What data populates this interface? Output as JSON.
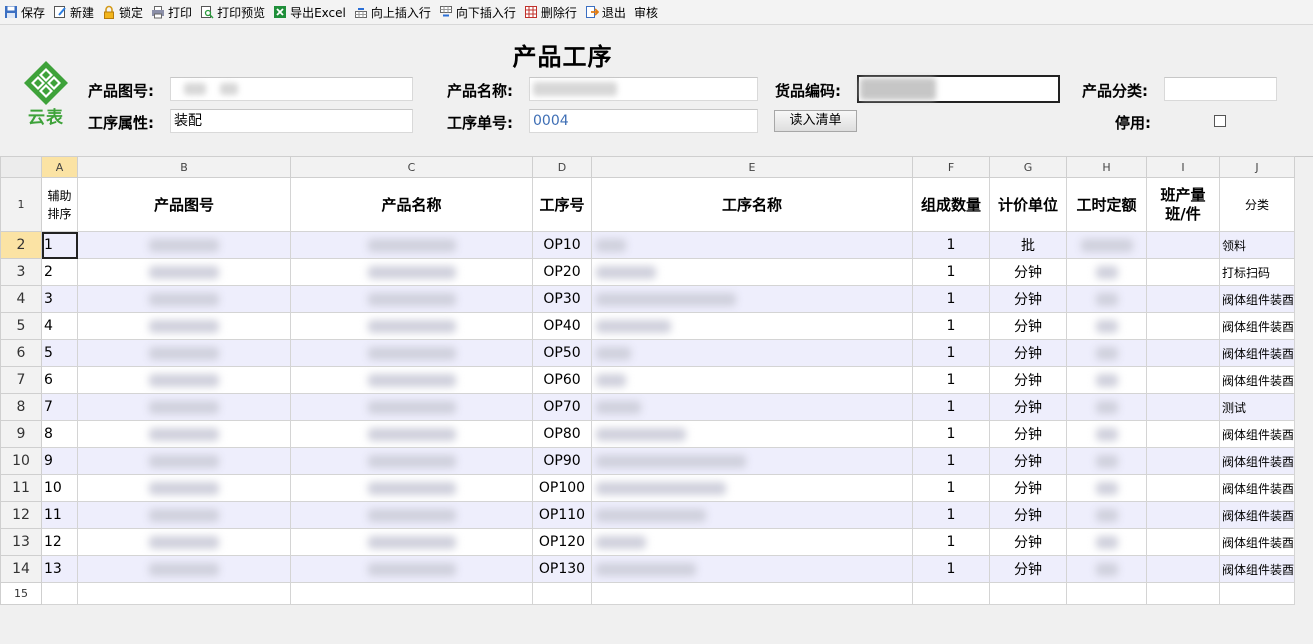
{
  "toolbar": {
    "save": "保存",
    "new": "新建",
    "lock": "锁定",
    "print": "打印",
    "print_preview": "打印预览",
    "export_excel": "导出Excel",
    "insert_above": "向上插入行",
    "insert_below": "向下插入行",
    "delete_row": "删除行",
    "exit": "退出",
    "audit": "审核"
  },
  "form": {
    "title": "产品工序",
    "logo_text": "云表",
    "product_drawing_label": "产品图号:",
    "product_name_label": "产品名称:",
    "goods_code_label": "货品编码:",
    "product_category_label": "产品分类:",
    "process_attr_label": "工序属性:",
    "process_attr_value": "装配",
    "process_no_label": "工序单号:",
    "process_no_value": "0004",
    "import_button": "读入清单",
    "disabled_label": "停用:"
  },
  "grid": {
    "col_letters": [
      "A",
      "B",
      "C",
      "D",
      "E",
      "F",
      "G",
      "H",
      "I",
      "J"
    ],
    "headers": [
      "辅助排序",
      "产品图号",
      "产品名称",
      "工序号",
      "工序名称",
      "组成数量",
      "计价单位",
      "工时定额",
      "班产量班/件",
      "分类"
    ],
    "header_a_lines": [
      "辅助",
      "排序"
    ],
    "header_i_lines": [
      "班产量",
      "班/件"
    ],
    "rows": [
      {
        "rn": "2",
        "seq": "1",
        "op": "OP10",
        "qty": "1",
        "unit": "批",
        "cat": "领料"
      },
      {
        "rn": "3",
        "seq": "2",
        "op": "OP20",
        "qty": "1",
        "unit": "分钟",
        "cat": "打标扫码"
      },
      {
        "rn": "4",
        "seq": "3",
        "op": "OP30",
        "qty": "1",
        "unit": "分钟",
        "cat": "阀体组件装酉"
      },
      {
        "rn": "5",
        "seq": "4",
        "op": "OP40",
        "qty": "1",
        "unit": "分钟",
        "cat": "阀体组件装酉"
      },
      {
        "rn": "6",
        "seq": "5",
        "op": "OP50",
        "qty": "1",
        "unit": "分钟",
        "cat": "阀体组件装酉"
      },
      {
        "rn": "7",
        "seq": "6",
        "op": "OP60",
        "qty": "1",
        "unit": "分钟",
        "cat": "阀体组件装酉"
      },
      {
        "rn": "8",
        "seq": "7",
        "op": "OP70",
        "qty": "1",
        "unit": "分钟",
        "cat": "测试"
      },
      {
        "rn": "9",
        "seq": "8",
        "op": "OP80",
        "qty": "1",
        "unit": "分钟",
        "cat": "阀体组件装酉"
      },
      {
        "rn": "10",
        "seq": "9",
        "op": "OP90",
        "qty": "1",
        "unit": "分钟",
        "cat": "阀体组件装酉"
      },
      {
        "rn": "11",
        "seq": "10",
        "op": "OP100",
        "qty": "1",
        "unit": "分钟",
        "cat": "阀体组件装酉"
      },
      {
        "rn": "12",
        "seq": "11",
        "op": "OP110",
        "qty": "1",
        "unit": "分钟",
        "cat": "阀体组件装酉"
      },
      {
        "rn": "13",
        "seq": "12",
        "op": "OP120",
        "qty": "1",
        "unit": "分钟",
        "cat": "阀体组件装酉"
      },
      {
        "rn": "14",
        "seq": "13",
        "op": "OP130",
        "qty": "1",
        "unit": "分钟",
        "cat": "阀体组件装酉"
      }
    ],
    "row_numbers": [
      "1",
      "15"
    ]
  },
  "colors": {
    "row_alt": "#eeeefc",
    "selected_header": "#fbe3a4",
    "process_no_text": "#3f6fb5",
    "logo_green": "#3ea23a"
  }
}
